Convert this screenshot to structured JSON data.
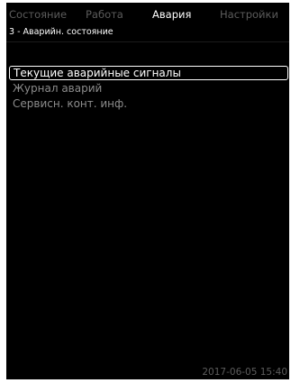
{
  "tabs": [
    {
      "label": "Состояние",
      "active": false
    },
    {
      "label": "Работа",
      "active": false
    },
    {
      "label": "Авария",
      "active": true
    },
    {
      "label": "Настройки",
      "active": false
    }
  ],
  "breadcrumb": "3 - Аварийн. состояние",
  "menu": {
    "items": [
      {
        "label": "Текущие аварийные сигналы",
        "selected": true
      },
      {
        "label": "Журнал аварий",
        "selected": false
      },
      {
        "label": "Сервисн. конт. инф.",
        "selected": false
      }
    ]
  },
  "status": {
    "datetime": "2017-06-05 15:40"
  },
  "colors": {
    "background": "#000000",
    "text_active": "#ffffff",
    "text_inactive": "#8c8c8c",
    "tab_inactive": "#5c5c5c"
  }
}
